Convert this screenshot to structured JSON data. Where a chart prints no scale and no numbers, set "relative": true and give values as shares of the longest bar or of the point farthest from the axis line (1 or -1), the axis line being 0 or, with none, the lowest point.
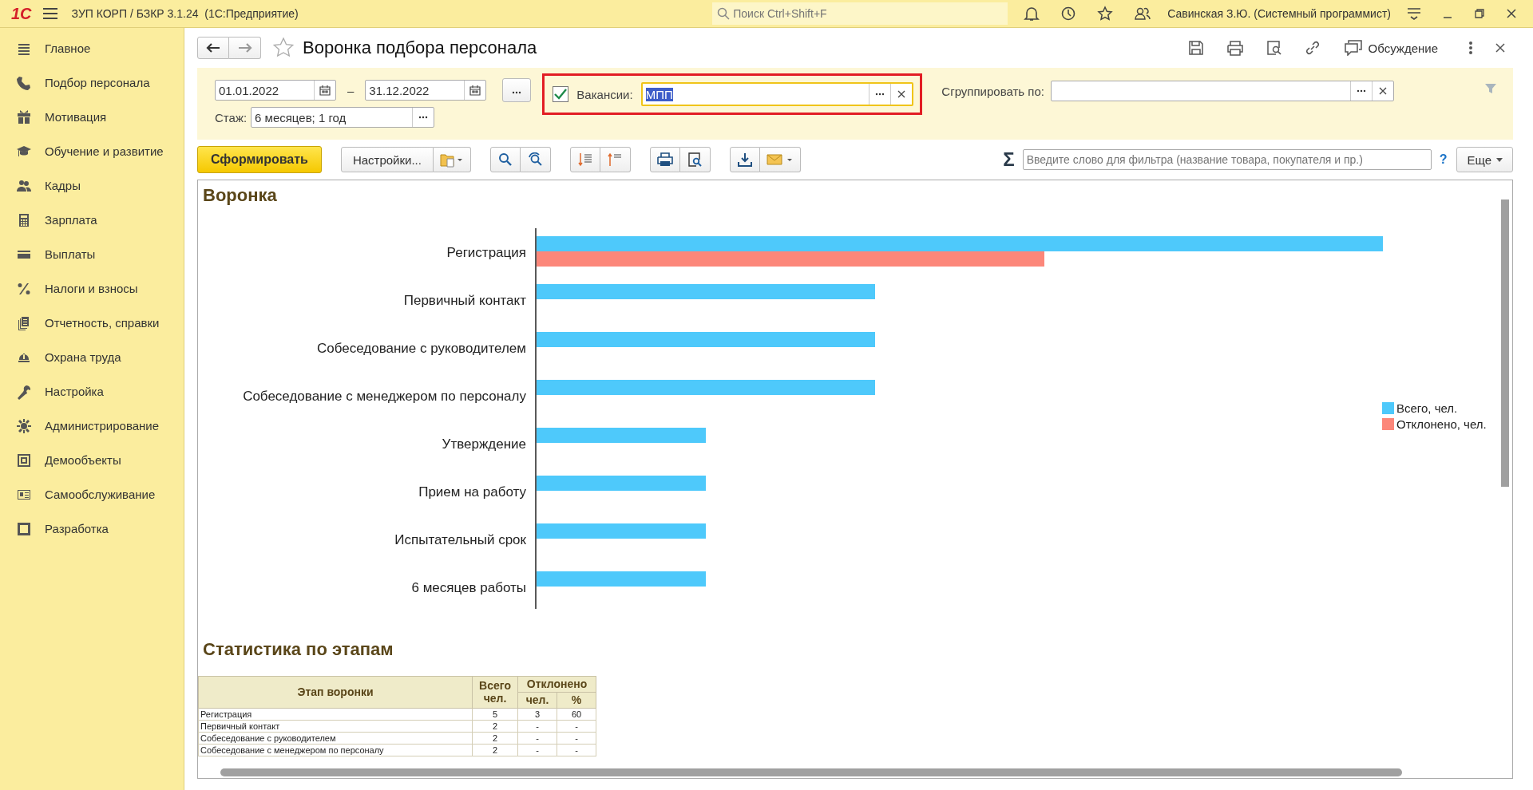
{
  "app_bar": {
    "logo": "1С",
    "title": "ЗУП КОРП / БЗКР 3.1.24  (1С:Предприятие)",
    "search": {
      "placeholder": "Поиск Ctrl+Shift+F"
    },
    "user": "Савинская З.Ю. (Системный программист)"
  },
  "sidebar": {
    "items": [
      {
        "label": "Главное"
      },
      {
        "label": "Подбор персонала"
      },
      {
        "label": "Мотивация"
      },
      {
        "label": "Обучение и развитие"
      },
      {
        "label": "Кадры"
      },
      {
        "label": "Зарплата"
      },
      {
        "label": "Выплаты"
      },
      {
        "label": "Налоги и взносы"
      },
      {
        "label": "Отчетность, справки"
      },
      {
        "label": "Охрана труда"
      },
      {
        "label": "Настройка"
      },
      {
        "label": "Администрирование"
      },
      {
        "label": "Демообъекты"
      },
      {
        "label": "Самообслуживание"
      },
      {
        "label": "Разработка"
      }
    ]
  },
  "form": {
    "title": "Воронка подбора персонала",
    "discussion": "Обсуждение"
  },
  "filters": {
    "date_from": "01.01.2022",
    "date_separator": "–",
    "date_to": "31.12.2022",
    "vacancies": {
      "label": "Вакансии:",
      "checked": true,
      "value": "МПП"
    },
    "group_by": {
      "label": "Сгруппировать по:"
    },
    "experience": {
      "label": "Стаж:",
      "value": "6 месяцев; 1 год"
    }
  },
  "toolbar": {
    "generate": "Сформировать",
    "settings": "Настройки...",
    "sigma": "Σ",
    "filter": {
      "placeholder": "Введите слово для фильтра (название товара, покупателя и пр.)"
    },
    "help": "?",
    "more": "Еще"
  },
  "report": {
    "chart_title": "Воронка",
    "chart_data": {
      "type": "bar",
      "orientation": "horizontal",
      "relative": true,
      "legend": true,
      "categories": [
        "Регистрация",
        "Первичный контакт",
        "Собеседование с руководителем",
        "Собеседование с менеджером по персоналу",
        "Утверждение",
        "Прием на работу",
        "Испытательный срок",
        "6 месяцев работы"
      ],
      "series": [
        {
          "name": "Всего, чел.",
          "color": "#4ec9fb",
          "values": [
            1,
            0.4,
            0.4,
            0.4,
            0.2,
            0.2,
            0.2,
            0.2
          ]
        },
        {
          "name": "Отклонено, чел.",
          "color": "#fc877a",
          "values": [
            0.6,
            null,
            null,
            null,
            null,
            null,
            null,
            null
          ]
        }
      ]
    },
    "stats_title": "Статистика по этапам",
    "table": {
      "columns": [
        {
          "label": "Этап воронки"
        },
        {
          "label": "Всего чел."
        },
        {
          "label": "Отклонено",
          "colspan": 2,
          "children": [
            "чел.",
            "%"
          ]
        }
      ],
      "rows": [
        [
          "Регистрация",
          "5",
          "3",
          "60"
        ],
        [
          "Первичный контакт",
          "2",
          "-",
          "-"
        ],
        [
          "Собеседование с руководителем",
          "2",
          "-",
          "-"
        ],
        [
          "Собеседование с менеджером по персоналу",
          "2",
          "-",
          "-"
        ]
      ]
    }
  }
}
